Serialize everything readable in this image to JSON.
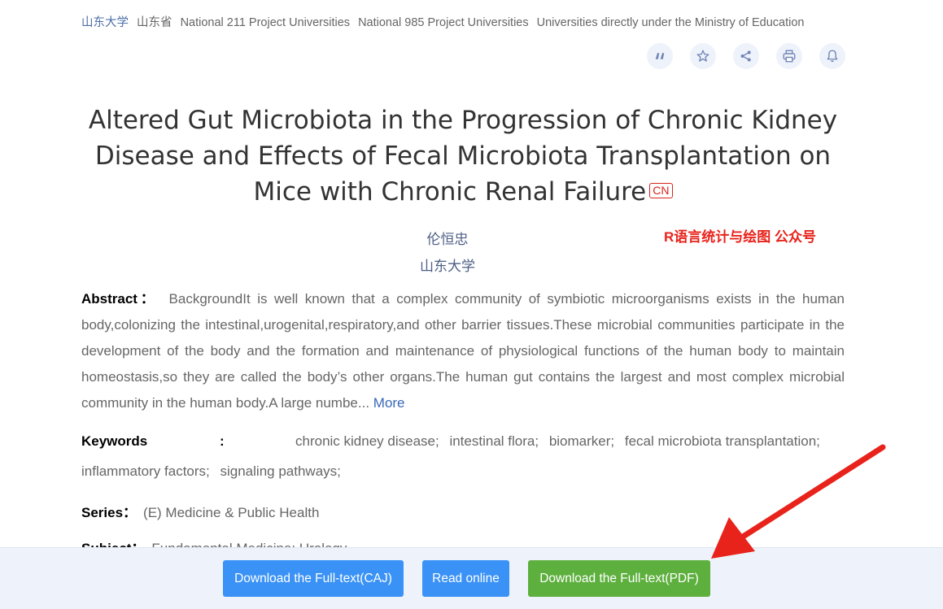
{
  "tags": [
    "山东大学",
    "山东省",
    "National 211 Project Universities",
    "National 985 Project Universities",
    "Universities directly under the Ministry of Education"
  ],
  "actions": [
    "quote-icon",
    "star-icon",
    "share-icon",
    "print-icon",
    "bell-icon"
  ],
  "article": {
    "title": "Altered Gut Microbiota in the Progression of Chronic Kidney Disease and Effects of Fecal Microbiota Transplantation on Mice with Chronic Renal Failure",
    "language_badge": "CN",
    "author": "伦恒忠",
    "affiliation": "山东大学",
    "abstract_label": "Abstract：",
    "abstract_text": "BackgroundIt is well known that a complex community of symbiotic microorganisms exists in the human body,colonizing the intestinal,urogenital,respiratory,and other barrier tissues.These microbial communities participate in the development of the body and the formation and maintenance of physiological functions of the human body to maintain homeostasis,so they are called the body’s other organs.The human gut contains the largest and most complex microbial community in the human body.A large numbe...",
    "more_label": "More",
    "keywords_label": "Keywords",
    "keywords_colon": ":",
    "keywords": [
      "chronic kidney disease;",
      "intestinal flora;",
      "biomarker;",
      "fecal microbiota transplantation;",
      "inflammatory factors;",
      "signaling pathways;"
    ],
    "series_label": "Series：",
    "series_value": "(E) Medicine & Public Health",
    "subject_label": "Subject：",
    "subject_value": "Fundamental Medicine; Urology"
  },
  "watermark": "R语言统计与绘图 公众号",
  "download": {
    "caj_label": "Download the Full-text(CAJ)",
    "read_label": "Read online",
    "pdf_label": "Download the Full-text(PDF)"
  },
  "colors": {
    "primary_button": "#3a92f6",
    "pdf_button": "#5eb03e",
    "annotation_red": "#e8231b"
  }
}
